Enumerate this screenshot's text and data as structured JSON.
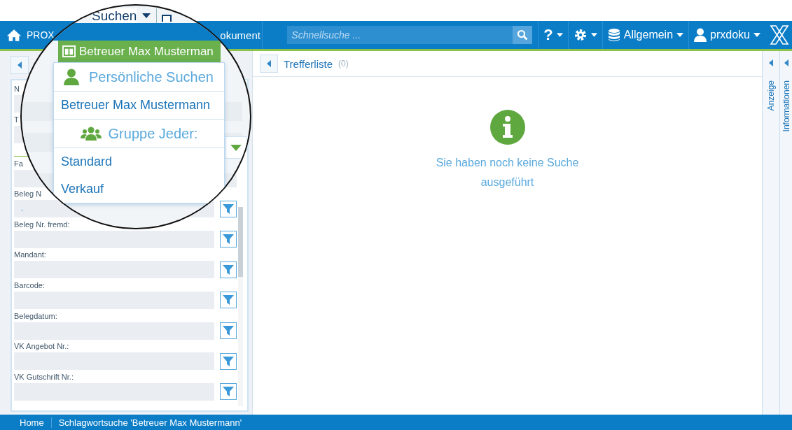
{
  "nav": {
    "brand": "PROX",
    "item": "okument",
    "help": "?",
    "search": {
      "placeholder": "Schnellsuche ..."
    },
    "database": "Allgemein",
    "user": "prxdoku"
  },
  "left_panel": {
    "fields": [
      {
        "label": "N",
        "kind": "text",
        "filter": false
      },
      {
        "label": "T",
        "kind": "select",
        "filter": false
      },
      {
        "label": "Fa",
        "kind": "text",
        "filter": false
      },
      {
        "label": "Beleg N",
        "kind": "text",
        "value": "-",
        "filter": true
      },
      {
        "label": "Beleg Nr. fremd:",
        "kind": "text",
        "filter": true
      },
      {
        "label": "Mandant:",
        "kind": "text",
        "filter": true
      },
      {
        "label": "Barcode:",
        "kind": "text",
        "filter": true
      },
      {
        "label": "Belegdatum:",
        "kind": "text",
        "filter": true
      },
      {
        "label": "VK Angebot Nr.:",
        "kind": "text",
        "filter": true
      },
      {
        "label": "VK Gutschrift Nr.:",
        "kind": "text",
        "filter": true
      }
    ]
  },
  "results": {
    "title": "Trefferliste",
    "count": "(0)",
    "message": "Sie haben noch keine Suche ausgeführt"
  },
  "side_tabs": [
    "Anzeige",
    "Informationen"
  ],
  "breadcrumb": [
    "Home",
    "Schlagwortsuche 'Betreuer Max Mustermann'"
  ],
  "magnifier": {
    "menu_title": "Suchen",
    "selected_search": "Betreuer Max Musterman",
    "groups": [
      {
        "title": "Persönliche Suchen",
        "kind": "personal",
        "items": [
          "Betreuer Max Mustermann"
        ]
      },
      {
        "title": "Gruppe Jeder:",
        "kind": "group",
        "items": [
          "Standard",
          "Verkauf"
        ]
      }
    ]
  }
}
